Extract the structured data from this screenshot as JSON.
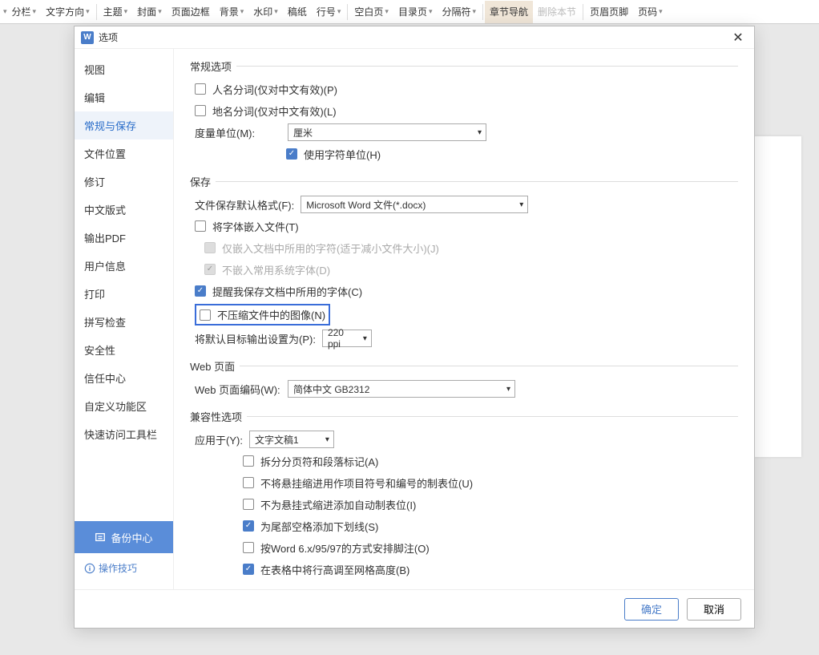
{
  "ribbon": {
    "items": [
      {
        "label": "分栏",
        "dd": true
      },
      {
        "label": "文字方向",
        "dd": true
      },
      {
        "label": "主题",
        "dd": true
      },
      {
        "label": "封面",
        "dd": true
      },
      {
        "label": "页面边框"
      },
      {
        "label": "背景",
        "dd": true
      },
      {
        "label": "水印",
        "dd": true
      },
      {
        "label": "稿纸"
      },
      {
        "label": "行号",
        "dd": true
      },
      {
        "label": "空白页",
        "dd": true
      },
      {
        "label": "目录页",
        "dd": true
      },
      {
        "label": "分隔符",
        "dd": true
      },
      {
        "label": "章节导航",
        "active": true
      },
      {
        "label": "删除本节",
        "disabled": true
      },
      {
        "label": "页眉页脚"
      },
      {
        "label": "页码",
        "dd": true
      }
    ]
  },
  "dialog": {
    "title": "选项",
    "sidebar": {
      "items": [
        "视图",
        "编辑",
        "常规与保存",
        "文件位置",
        "修订",
        "中文版式",
        "输出PDF",
        "用户信息",
        "打印",
        "拼写检查",
        "安全性",
        "信任中心",
        "自定义功能区",
        "快速访问工具栏"
      ],
      "selectedIndex": 2,
      "backup": "备份中心",
      "tips": "操作技巧"
    },
    "content": {
      "general": {
        "title": "常规选项",
        "nameSeg": "人名分词(仅对中文有效)(P)",
        "placeSeg": "地名分词(仅对中文有效)(L)",
        "unitLabel": "度量单位(M):",
        "unitValue": "厘米",
        "useCharUnit": "使用字符单位(H)"
      },
      "save": {
        "title": "保存",
        "formatLabel": "文件保存默认格式(F):",
        "formatValue": "Microsoft Word 文件(*.docx)",
        "embedFonts": "将字体嵌入文件(T)",
        "embedUsedOnly": "仅嵌入文档中所用的字符(适于减小文件大小)(J)",
        "noEmbedSystem": "不嵌入常用系统字体(D)",
        "remindFonts": "提醒我保存文档中所用的字体(C)",
        "noCompressImg": "不压缩文件中的图像(N)",
        "defaultOutputLabel": "将默认目标输出设置为(P):",
        "defaultOutputValue": "220 ppi"
      },
      "web": {
        "title": "Web 页面",
        "encodingLabel": "Web 页面编码(W):",
        "encodingValue": "简体中文 GB2312"
      },
      "compat": {
        "title": "兼容性选项",
        "applyLabel": "应用于(Y):",
        "applyValue": "文字文稿1",
        "splitPageBreak": "拆分分页符和段落标记(A)",
        "noHangingIndent": "不将悬挂缩进用作项目符号和编号的制表位(U)",
        "noAutoTabHanging": "不为悬挂式缩进添加自动制表位(I)",
        "underlineTrailing": "为尾部空格添加下划线(S)",
        "word6Footnote": "按Word 6.x/95/97的方式安排脚注(O)",
        "tableRowHeight": "在表格中将行高调至网格高度(B)"
      }
    },
    "buttons": {
      "ok": "确定",
      "cancel": "取消"
    }
  }
}
